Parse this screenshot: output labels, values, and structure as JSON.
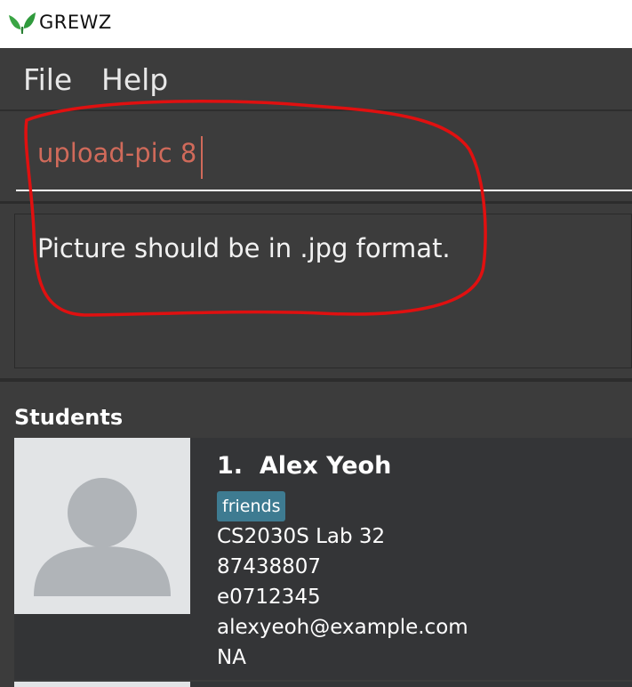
{
  "window": {
    "title": "GREWZ",
    "icon": "leaf-icon"
  },
  "menu": {
    "file": "File",
    "help": "Help"
  },
  "command": {
    "value": "upload-pic 8"
  },
  "result": {
    "message": "Picture should be in .jpg format."
  },
  "students": {
    "title": "Students",
    "list": [
      {
        "index": "1.",
        "name": "Alex Yeoh",
        "tag": "friends",
        "class": "CS2030S Lab 32",
        "phone": "87438807",
        "student_id": "e0712345",
        "email": "alexyeoh@example.com",
        "note": "NA",
        "avatar_icon": "user-placeholder-icon"
      }
    ]
  },
  "colors": {
    "background": "#3c3c3c",
    "command_text": "#d06a5a",
    "tag_bg": "#3e7b91",
    "annotation": "#e01010",
    "leaf": "#3aa544"
  }
}
